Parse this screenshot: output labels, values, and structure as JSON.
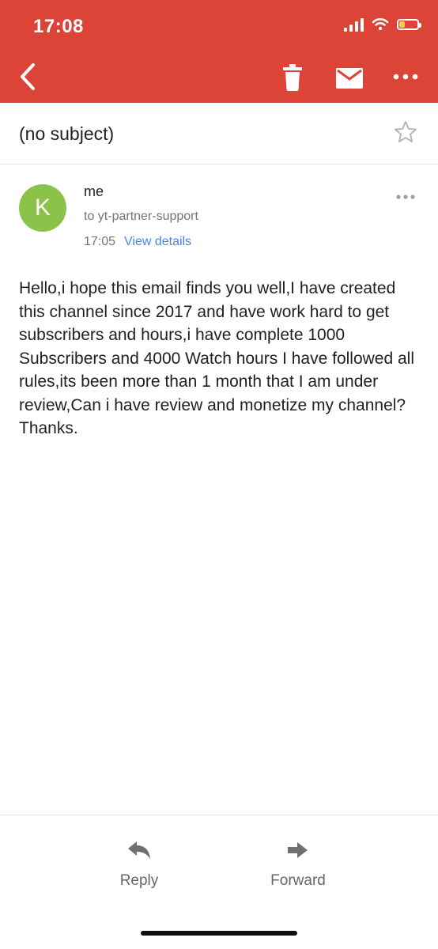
{
  "status_bar": {
    "time": "17:08",
    "battery_level": 0.3
  },
  "toolbar": {
    "back_icon": "chevron-left-icon",
    "delete_icon": "trash-icon",
    "mark_unread_icon": "mail-icon",
    "more_icon": "more-horizontal-icon"
  },
  "email": {
    "subject": "(no subject)",
    "star_icon": "star-outline-icon",
    "sender": {
      "avatar_letter": "K",
      "avatar_color": "#8bc34a",
      "name": "me",
      "recipients": "to yt-partner-support",
      "time": "17:05",
      "view_details_label": "View details"
    },
    "body": "Hello,i hope this email finds you well,I have created this channel since 2017 and have work hard to get subscribers and hours,i have complete 1000 Subscribers and 4000 Watch hours I have followed all rules,its been more than 1 month that I am under review,Can i have review and monetize my channel? Thanks."
  },
  "actions": {
    "reply_label": "Reply",
    "forward_label": "Forward"
  },
  "colors": {
    "header": "#db4437",
    "link": "#4285f4",
    "text": "#212121",
    "secondary_text": "#757575"
  }
}
